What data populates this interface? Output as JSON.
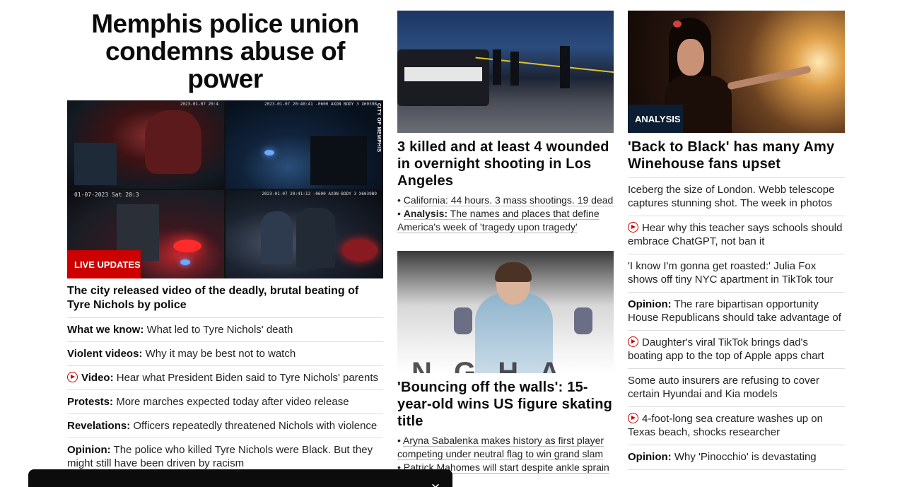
{
  "lead": {
    "headline": "Memphis police union condemns abuse of power",
    "badge": "LIVE UPDATES",
    "image_overlay": "CITY OF MEMPHIS",
    "cam_stamps": [
      "2023-01-07 20:4",
      "2023-01-07 20:40:41 -0600\nAXON BODY 3 X6039B",
      "01-07-2023 Sat 20:3",
      "2023-01-07 20:41:12 -0600\nAXON BODY 3 X6039B9"
    ],
    "lead_text": "The city released video of the deadly, brutal beating of Tyre Nichols by police",
    "items": [
      {
        "prefix": "What we know:",
        "text": " What led to Tyre Nichols' death",
        "video": false
      },
      {
        "prefix": "Violent videos:",
        "text": " Why it may be best not to watch",
        "video": false
      },
      {
        "prefix": "Video:",
        "text": " Hear what President Biden said to Tyre Nichols' parents",
        "video": true
      },
      {
        "prefix": "Protests:",
        "text": " More marches expected today after video release",
        "video": false
      },
      {
        "prefix": "Revelations:",
        "text": " Officers repeatedly threatened Nichols with violence",
        "video": false
      },
      {
        "prefix": "Opinion:",
        "text": " The police who killed Tyre Nichols were Black. But they might still have been driven by racism",
        "video": false
      }
    ]
  },
  "middle": {
    "story1": {
      "title": "3 killed and at least 4 wounded in overnight shooting in Los Angeles",
      "sub1": "California: 44 hours. 3 mass shootings. 19 dead",
      "sub2_prefix": "Analysis:",
      "sub2_text": " The names and places that define America's week of 'tragedy upon tragedy'"
    },
    "story2": {
      "title": "'Bouncing off the walls': 15-year-old wins US figure skating title",
      "sub1": "Aryna Sabalenka makes history as first player competing under neutral flag to win grand slam",
      "sub2": "Patrick Mahomes will start despite ankle sprain"
    }
  },
  "right": {
    "badge": "ANALYSIS",
    "title": "'Back to Black' has many Amy Winehouse fans upset",
    "items": [
      {
        "prefix": "",
        "text": "Iceberg the size of London. Webb telescope captures stunning shot. The week in photos",
        "video": false
      },
      {
        "prefix": "",
        "text": "Hear why this teacher says schools should embrace ChatGPT, not ban it",
        "video": true
      },
      {
        "prefix": "",
        "text": "'I know I'm gonna get roasted:' Julia Fox shows off tiny NYC apartment in TikTok tour",
        "video": false
      },
      {
        "prefix": "Opinion:",
        "text": " The rare bipartisan opportunity House Republicans should take advantage of",
        "video": false
      },
      {
        "prefix": "",
        "text": "Daughter's viral TikTok brings dad's boating app to the top of Apple apps chart",
        "video": true
      },
      {
        "prefix": "",
        "text": "Some auto insurers are refusing to cover certain Hyundai and Kia models",
        "video": false
      },
      {
        "prefix": "",
        "text": "4-foot-long sea creature washes up on Texas beach, shocks researcher",
        "video": true
      },
      {
        "prefix": "Opinion:",
        "text": " Why 'Pinocchio' is devastating",
        "video": false
      }
    ]
  },
  "overlay": {
    "close_symbol": "×"
  },
  "colors": {
    "live_red": "#cc0000",
    "analysis_navy": "#0c1e33",
    "divider": "#dddddd"
  }
}
